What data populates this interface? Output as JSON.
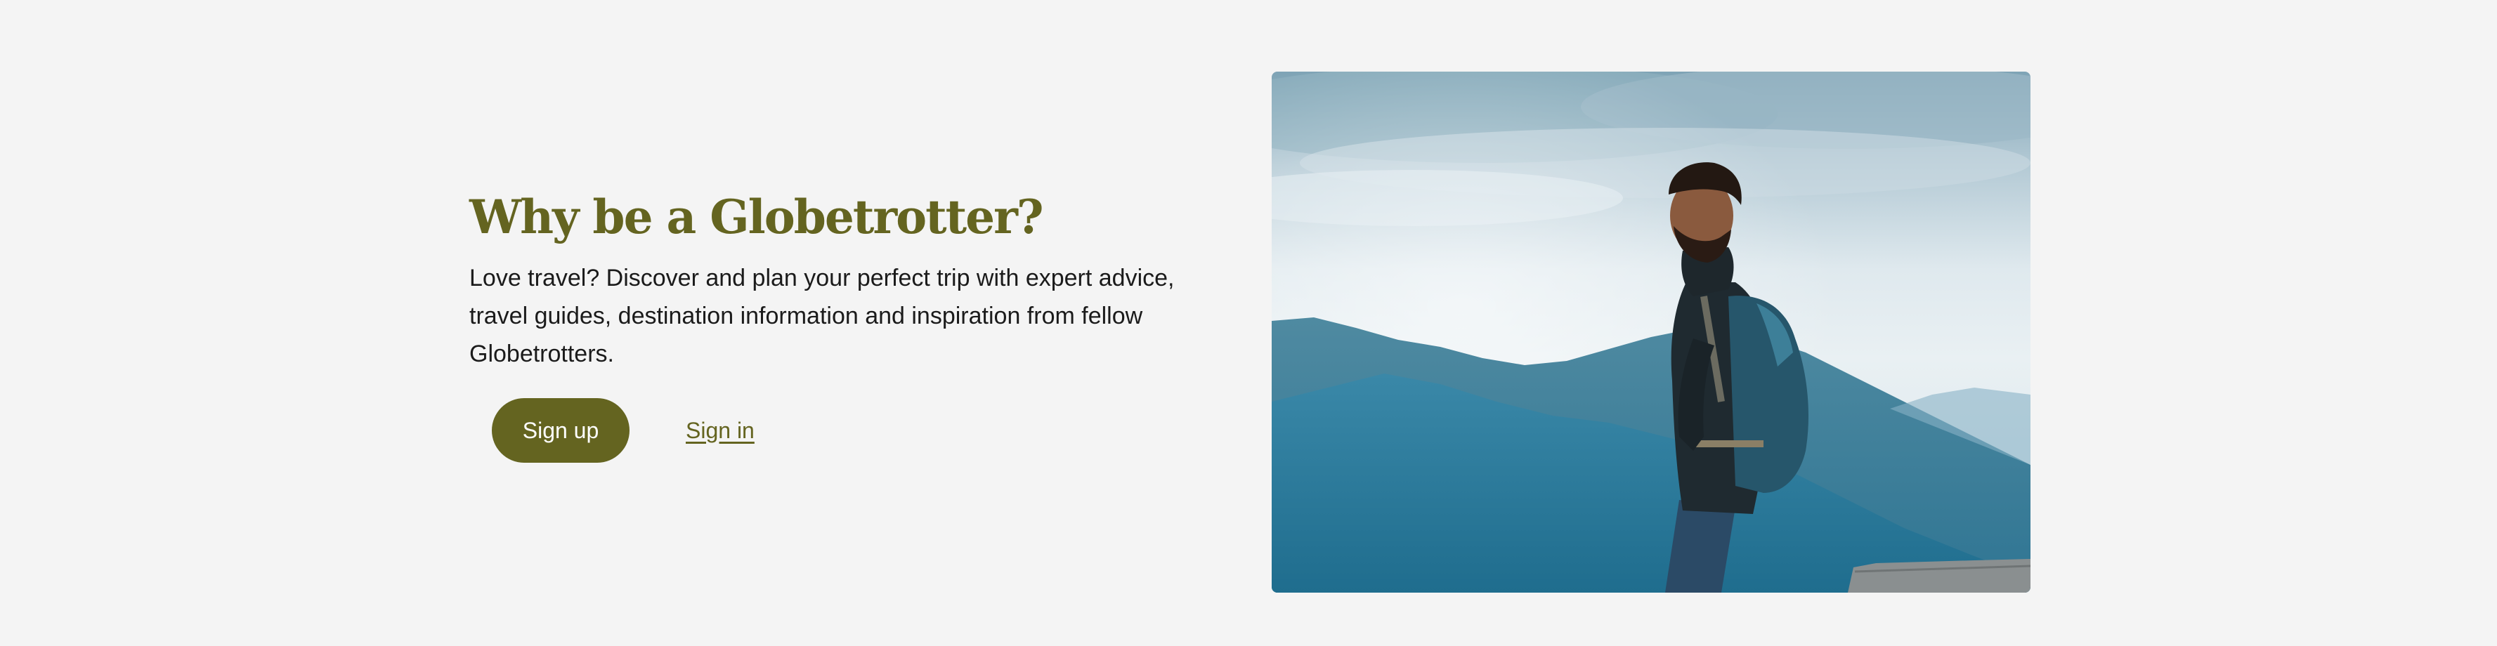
{
  "hero": {
    "heading": "Why be a Globetrotter?",
    "body": "Love travel? Discover and plan your perfect trip with expert advice, travel guides, destination information and inspiration from fellow Globetrotters.",
    "signup_label": "Sign up",
    "signin_label": "Sign in"
  },
  "colors": {
    "brand_olive": "#646420",
    "background": "#f4f4f4",
    "text": "#1b1b1b",
    "button_text": "#ffffff"
  }
}
